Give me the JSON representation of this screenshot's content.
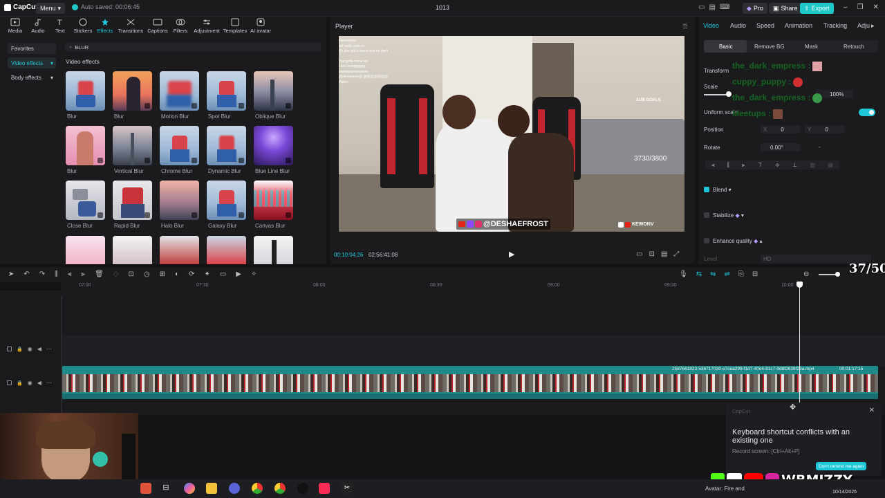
{
  "titlebar": {
    "logo": "CapCut",
    "menu_label": "Menu",
    "autosave": "Auto saved: 00:06:45",
    "project_title": "1013",
    "pro_label": "Pro",
    "share_label": "Share",
    "export_label": "Export"
  },
  "left_tabs": [
    {
      "label": "Media",
      "icon": "media-icon"
    },
    {
      "label": "Audio",
      "icon": "audio-icon"
    },
    {
      "label": "Text",
      "icon": "text-icon"
    },
    {
      "label": "Stickers",
      "icon": "stickers-icon"
    },
    {
      "label": "Effects",
      "icon": "effects-icon"
    },
    {
      "label": "Transitions",
      "icon": "transitions-icon"
    },
    {
      "label": "Captions",
      "icon": "captions-icon"
    },
    {
      "label": "Filters",
      "icon": "filters-icon"
    },
    {
      "label": "Adjustment",
      "icon": "adjustment-icon"
    },
    {
      "label": "Templates",
      "icon": "templates-icon"
    },
    {
      "label": "AI avatar",
      "icon": "ai-avatar-icon"
    }
  ],
  "sidebar": {
    "favorites": "Favorites",
    "video_effects": "Video effects",
    "body_effects": "Body effects"
  },
  "effects_panel": {
    "search_value": "BLUR",
    "section_title": "Video effects",
    "items": [
      {
        "label": "Blur"
      },
      {
        "label": "Blur"
      },
      {
        "label": "Motion Blur"
      },
      {
        "label": "Spot Blur"
      },
      {
        "label": "Oblique Blur"
      },
      {
        "label": "Blur"
      },
      {
        "label": "Vertical Blur"
      },
      {
        "label": "Chrome Blur"
      },
      {
        "label": "Dynamic Blur"
      },
      {
        "label": "Blue Line Blur"
      },
      {
        "label": "Close Blur"
      },
      {
        "label": "Rapid Blur"
      },
      {
        "label": "Halo Blur"
      },
      {
        "label": "Galaxy Blur"
      },
      {
        "label": "Canvas Blur"
      }
    ]
  },
  "player": {
    "title": "Player",
    "current_time": "00:10:04:26",
    "total_time": "02:56:41:08",
    "overlay_counter": "3730/3800",
    "sub_goals_title": "SUB GOALS",
    "handle": "@DESHAEFROST",
    "handle2": "KEWONV",
    "chat": [
      "lmaoooooo",
      "wtf really goin on",
      "It's bon got a beard and he don't",
      "You gotta come on",
      "I am cryingggggg",
      "awwwwwwwwwww",
      "@alexaaavtv@ @@@@@@@",
      "Weird"
    ]
  },
  "right_panel": {
    "tabs": [
      "Video",
      "Audio",
      "Speed",
      "Animation",
      "Tracking",
      "Adju"
    ],
    "subtabs": [
      "Basic",
      "Remove BG",
      "Mask",
      "Retouch"
    ],
    "transform": "Transform",
    "scale": "Scale",
    "scale_value": "100%",
    "uniform_scale": "Uniform scale",
    "position": "Position",
    "pos_x_label": "X",
    "pos_x": "0",
    "pos_y_label": "Y",
    "pos_y": "0",
    "rotate": "Rotate",
    "rotate_value": "0.00°",
    "rotate_dash": "-",
    "blend": "Blend",
    "stabilize": "Stabilize",
    "enhance_quality": "Enhance quality",
    "level": "Level",
    "level_value": "HD"
  },
  "chat_overlay": [
    {
      "name": "the_dark_empress :"
    },
    {
      "name": "cuppy_puppy :"
    },
    {
      "name": "the_dark_empress :"
    },
    {
      "name": "Meetups :"
    }
  ],
  "sub_overlay": "37/50",
  "timeline": {
    "ticks": [
      "07:00",
      "07:30",
      "08:00",
      "08:30",
      "09:00",
      "09:30",
      "10:00"
    ],
    "clip_name": "2587661823-536717030-e7cea299-f1d7-40e4-91c7-9d8f2639f29a.mp4",
    "clip_duration": "00:01:17:15"
  },
  "toast": {
    "app": "CapCut",
    "message": "Keyboard shortcut conflicts with an existing one",
    "detail": "Record screen: [Ctrl+Alt+P]",
    "button": "Don't remind me again"
  },
  "stream_overlay": {
    "name": "WBMIZZY"
  },
  "taskbar": {
    "weather": "Avatar: Fire and",
    "date": "10/14/2025"
  },
  "colors": {
    "accent": "#1ec8d8",
    "clip": "#1e8a8a",
    "export": "#1ec8c8"
  }
}
